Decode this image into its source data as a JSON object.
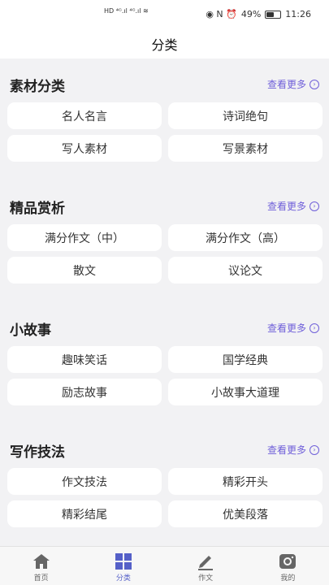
{
  "status_bar": {
    "network": "HD ⁴ᴳ.ıl ⁴ᴳ.ıl ≋",
    "icons_text": "◉ N ⏰",
    "battery": "49%",
    "battery_level": 0.49,
    "time": "11:26"
  },
  "header": {
    "title": "分类"
  },
  "more_label": "查看更多",
  "sections": [
    {
      "title": "素材分类",
      "items": [
        "名人名言",
        "诗词绝句",
        "写人素材",
        "写景素材"
      ]
    },
    {
      "title": "精品赏析",
      "items": [
        "满分作文（中）",
        "满分作文（高）",
        "散文",
        "议论文"
      ]
    },
    {
      "title": "小故事",
      "items": [
        "趣味笑话",
        "国学经典",
        "励志故事",
        "小故事大道理"
      ]
    },
    {
      "title": "写作技法",
      "items": [
        "作文技法",
        "精彩开头",
        "精彩结尾",
        "优美段落"
      ]
    }
  ],
  "tabbar": {
    "tabs": [
      {
        "label": "首页",
        "icon": "home-icon"
      },
      {
        "label": "分类",
        "icon": "grid-icon"
      },
      {
        "label": "作文",
        "icon": "pen-icon"
      },
      {
        "label": "我的",
        "icon": "camera-icon"
      }
    ],
    "active_tab": "分类",
    "active_color": "#5560c8",
    "inactive_color": "#666666"
  }
}
